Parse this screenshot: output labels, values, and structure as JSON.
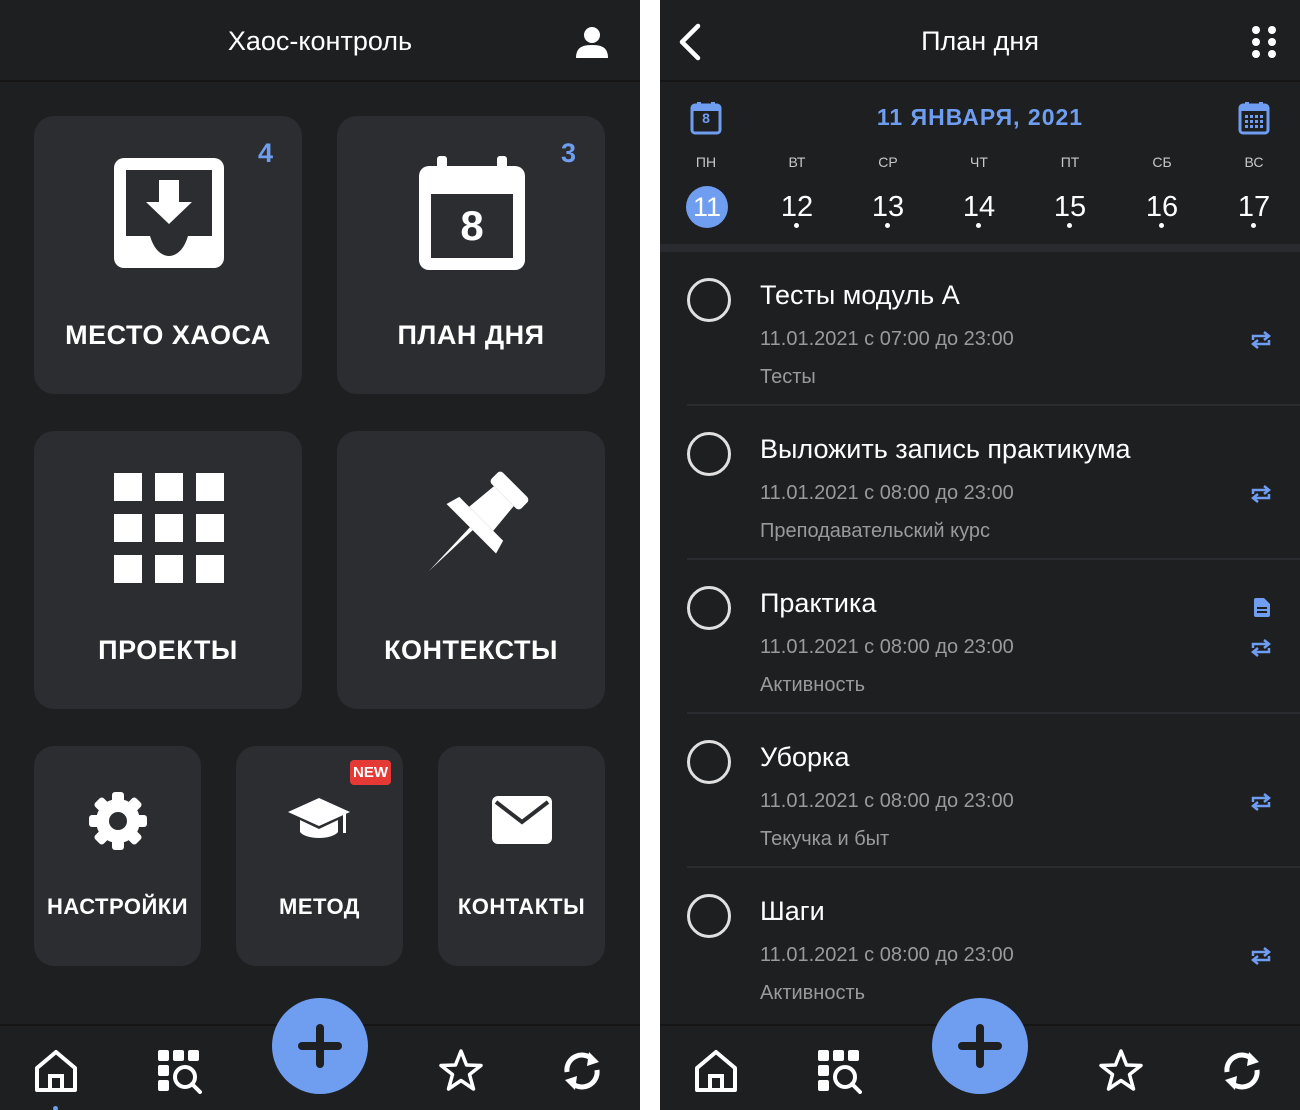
{
  "home": {
    "title": "Хаос-контроль",
    "tiles": {
      "chaos": {
        "label": "МЕСТО ХАОСА",
        "badge": "4"
      },
      "dayplan": {
        "label": "ПЛАН ДНЯ",
        "badge": "3",
        "calendar_number": "8"
      },
      "projects": {
        "label": "ПРОЕКТЫ"
      },
      "contexts": {
        "label": "КОНТЕКСТЫ"
      },
      "settings": {
        "label": "НАСТРОЙКИ"
      },
      "method": {
        "label": "МЕТОД",
        "badge": "NEW"
      },
      "contacts": {
        "label": "КОНТАКТЫ"
      }
    }
  },
  "plan": {
    "title": "План дня",
    "date_title": "11 ЯНВАРЯ, 2021",
    "calendar_icon_number": "8",
    "week": [
      {
        "weekday": "ПН",
        "day": "11",
        "active": true
      },
      {
        "weekday": "ВТ",
        "day": "12"
      },
      {
        "weekday": "СР",
        "day": "13"
      },
      {
        "weekday": "ЧТ",
        "day": "14"
      },
      {
        "weekday": "ПТ",
        "day": "15"
      },
      {
        "weekday": "СБ",
        "day": "16"
      },
      {
        "weekday": "ВС",
        "day": "17"
      }
    ],
    "tasks": [
      {
        "title": "Тесты модуль А",
        "time": "11.01.2021 с 07:00 до 23:00",
        "context": "Тесты"
      },
      {
        "title": "Выложить запись практикума",
        "time": "11.01.2021 с 08:00 до 23:00",
        "context": "Преподавательский курс"
      },
      {
        "title": "Практика",
        "time": "11.01.2021 с 08:00 до 23:00",
        "context": "Активность"
      },
      {
        "title": "Уборка",
        "time": "11.01.2021 с 08:00 до 23:00",
        "context": "Текучка и быт"
      },
      {
        "title": "Шаги",
        "time": "11.01.2021 с 08:00 до 23:00",
        "context": "Активность"
      }
    ]
  },
  "colors": {
    "accent": "#6f9ef1",
    "background": "#1e1f21",
    "tile": "#2c2d30",
    "new_badge": "#e53935"
  },
  "icons": [
    "user-icon",
    "inbox-icon",
    "calendar-icon",
    "grid-icon",
    "pin-icon",
    "gear-icon",
    "graduation-cap-icon",
    "mail-icon",
    "home-icon",
    "search-list-icon",
    "plus-icon",
    "star-icon",
    "sync-icon",
    "back-icon",
    "dots-grid-icon",
    "calendar-grid-icon",
    "repeat-icon",
    "document-icon"
  ]
}
